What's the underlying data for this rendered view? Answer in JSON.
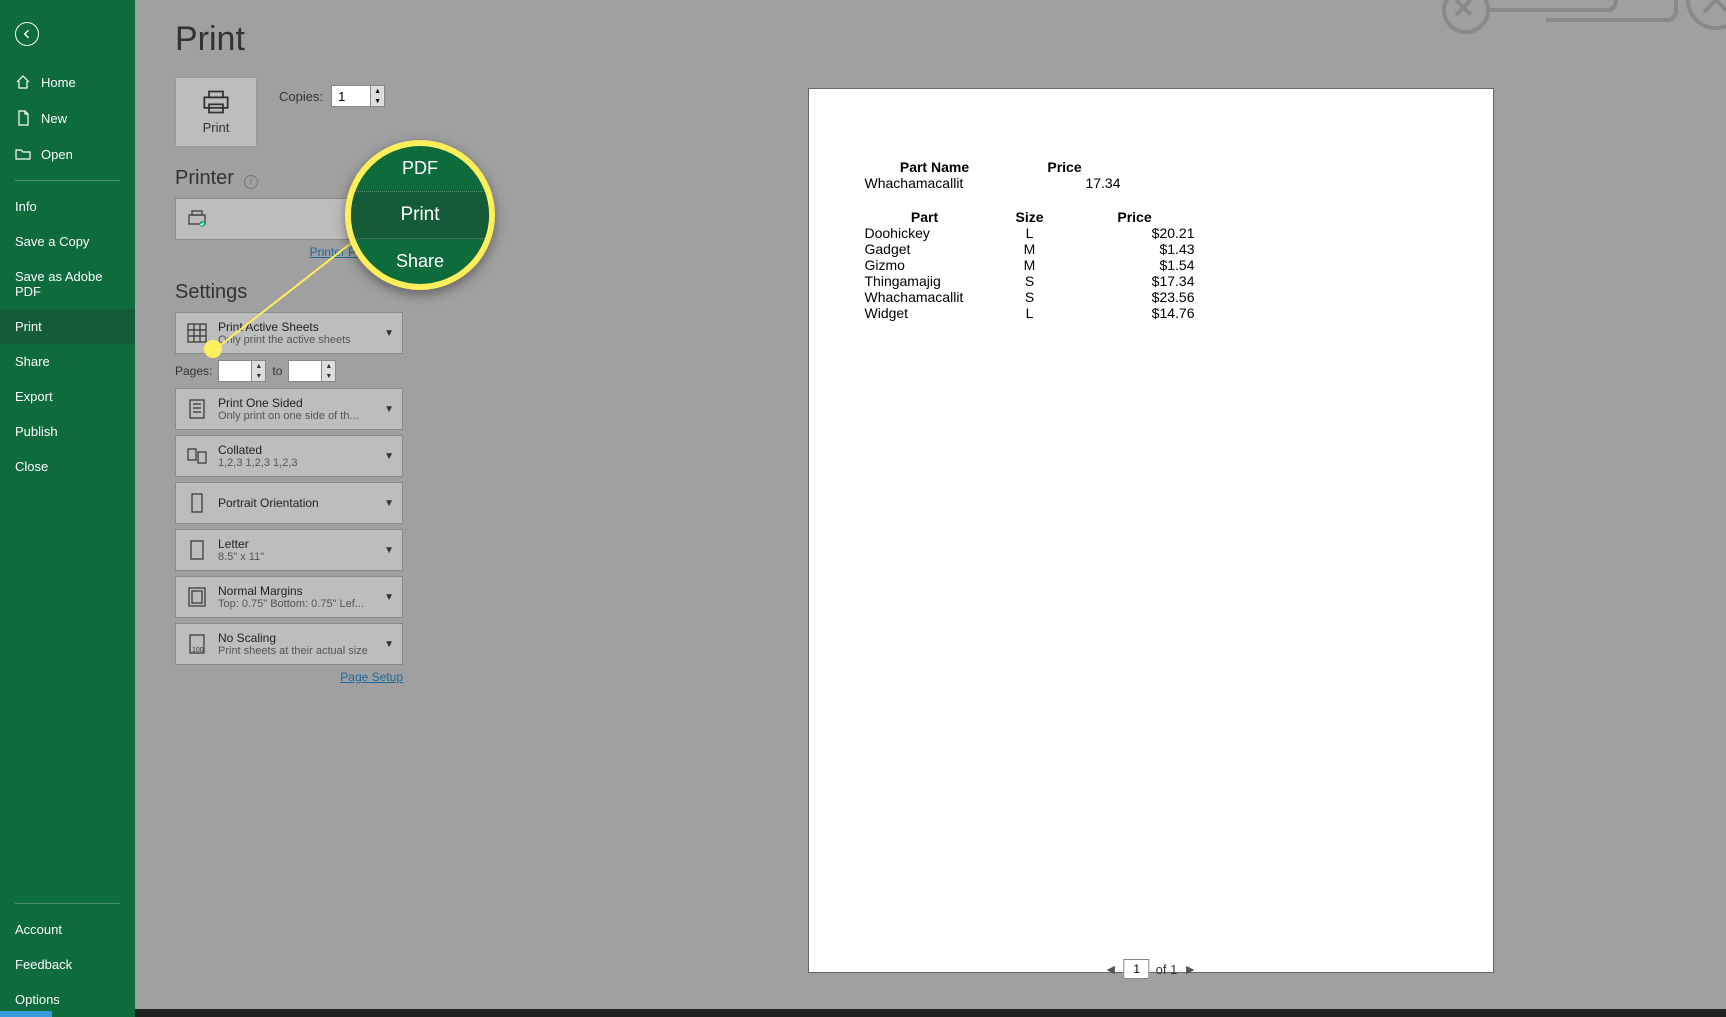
{
  "sidebar": {
    "home": "Home",
    "new": "New",
    "open": "Open",
    "info": "Info",
    "save_copy": "Save a Copy",
    "save_adobe": "Save as Adobe PDF",
    "print": "Print",
    "share": "Share",
    "export": "Export",
    "publish": "Publish",
    "close": "Close",
    "account": "Account",
    "feedback": "Feedback",
    "options": "Options"
  },
  "page_title": "Print",
  "print_button": "Print",
  "copies": {
    "label": "Copies:",
    "value": "1"
  },
  "printer_section": "Printer",
  "printer_props": "Printer Properties",
  "settings_section": "Settings",
  "dd": {
    "active_sheets": {
      "title": "Print Active Sheets",
      "sub": "Only print the active sheets"
    },
    "one_sided": {
      "title": "Print One Sided",
      "sub": "Only print on one side of th..."
    },
    "collated": {
      "title": "Collated",
      "sub": "1,2,3    1,2,3    1,2,3"
    },
    "orientation": {
      "title": "Portrait Orientation"
    },
    "paper": {
      "title": "Letter",
      "sub": "8.5\" x 11\""
    },
    "margins": {
      "title": "Normal Margins",
      "sub": "Top: 0.75\" Bottom: 0.75\" Lef..."
    },
    "scaling": {
      "title": "No Scaling",
      "sub": "Print sheets at their actual size"
    }
  },
  "pages": {
    "label": "Pages:",
    "to": "to"
  },
  "page_setup": "Page Setup",
  "pager": {
    "current": "1",
    "of": "of 1"
  },
  "zoom": {
    "pdf": "PDF",
    "print": "Print",
    "share": "Share"
  },
  "preview": {
    "t1": {
      "h1": "Part Name",
      "h2": "Price",
      "r": [
        "Whachamacallit",
        "17.34"
      ]
    },
    "t2": {
      "h": [
        "Part",
        "Size",
        "Price"
      ],
      "rows": [
        [
          "Doohickey",
          "L",
          "$20.21"
        ],
        [
          "Gadget",
          "M",
          "$1.43"
        ],
        [
          "Gizmo",
          "M",
          "$1.54"
        ],
        [
          "Thingamajig",
          "S",
          "$17.34"
        ],
        [
          "Whachamacallit",
          "S",
          "$23.56"
        ],
        [
          "Widget",
          "L",
          "$14.76"
        ]
      ]
    }
  }
}
